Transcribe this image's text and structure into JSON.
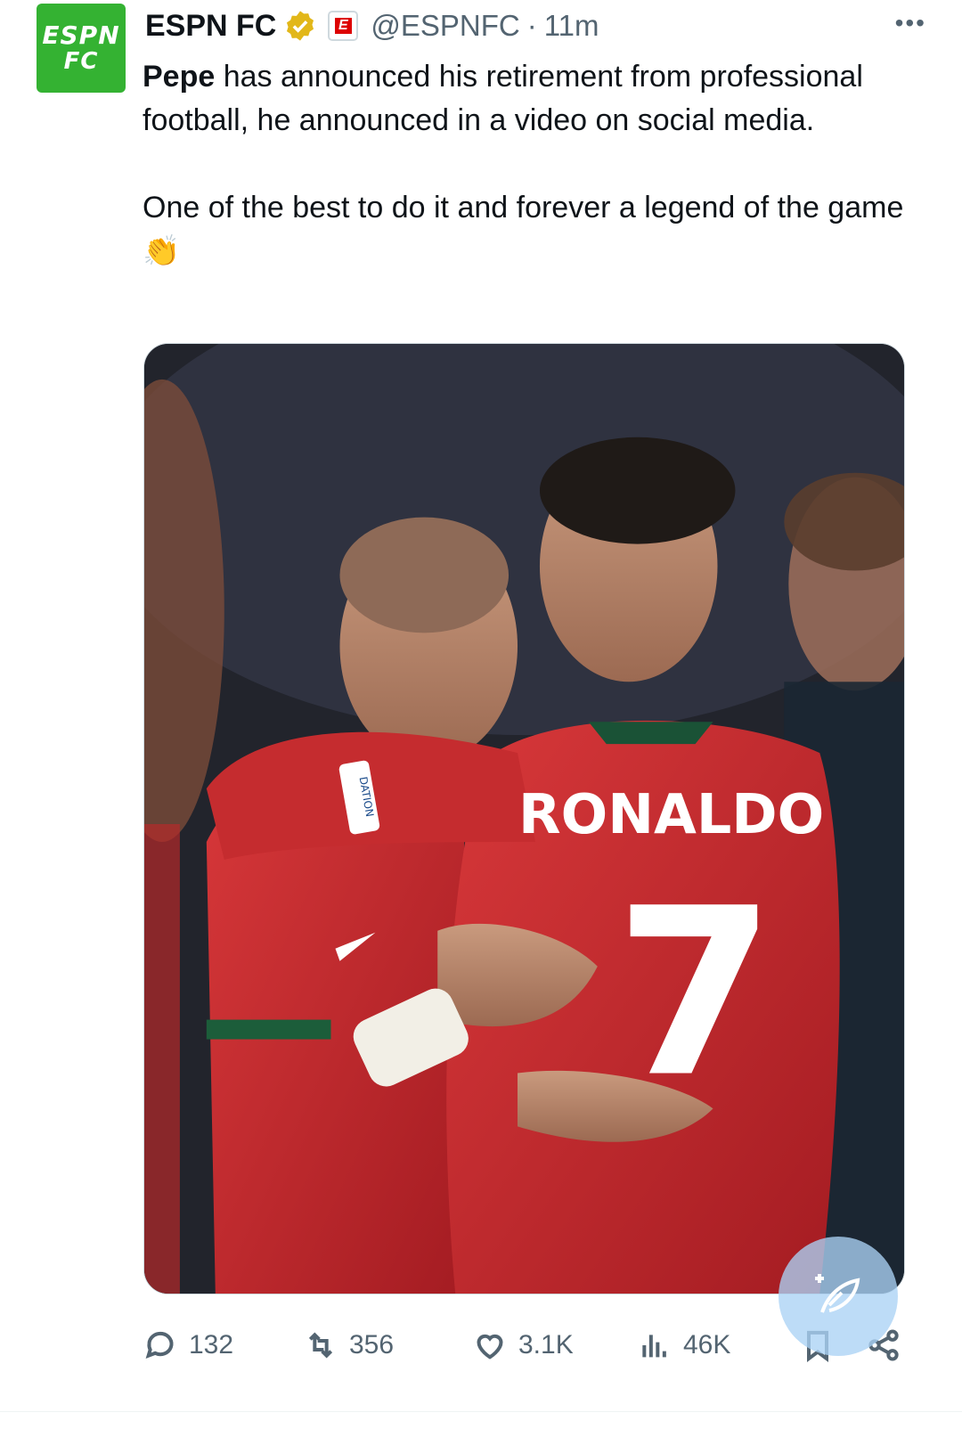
{
  "account": {
    "avatar_line1": "ESPN",
    "avatar_line2": "FC",
    "name": "ESPN FC",
    "affiliate_badge": "E",
    "handle": "@ESPNFC",
    "separator": "·",
    "time": "11m",
    "more_label": "•••"
  },
  "tweet": {
    "bold_lead": "Pepe",
    "line1_rest": " has announced his retirement from professional football, he announced in a video on social media.",
    "line2": "One of the best to do it and forever a legend of the game 👏"
  },
  "media": {
    "jersey_name": "RONALDO",
    "jersey_number": "7",
    "sleeve_text": "DATION"
  },
  "actions": {
    "replies": "132",
    "reposts": "356",
    "likes": "3.1K",
    "views": "46K"
  },
  "colors": {
    "brand_green": "#34b232",
    "verified_gold": "#e2b719",
    "muted_text": "#536471",
    "jersey_red": "#c8272b"
  }
}
